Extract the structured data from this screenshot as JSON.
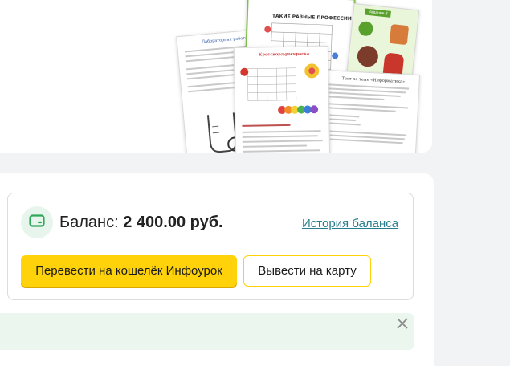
{
  "collage": {
    "sheet_titles": [
      "Лабораторная работа №1",
      "ТАКИЕ РАЗНЫЕ ПРОФЕССИИ",
      "Кроссворд-раскраска",
      "Тест по теме «Информатика»",
      "Задание 8"
    ]
  },
  "balance": {
    "label": "Баланс:",
    "amount": "2 400.00 руб.",
    "history_link": "История баланса"
  },
  "actions": {
    "transfer_label": "Перевести на кошелёк Инфоурок",
    "withdraw_label": "Вывести на карту"
  },
  "colors": {
    "accent_yellow": "#ffd20a",
    "link_teal": "#2a7d8e",
    "wallet_green": "#2fa85b",
    "notice_bg": "#eaf6ee"
  },
  "icons": {
    "wallet": "wallet-icon",
    "close": "close-icon"
  }
}
